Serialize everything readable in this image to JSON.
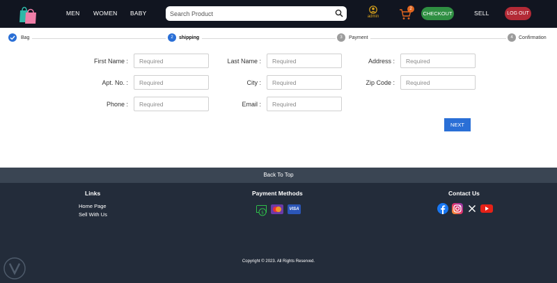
{
  "nav": {
    "links": [
      "MEN",
      "WOMEN",
      "BABY"
    ],
    "search_placeholder": "Search Product",
    "user_name": "admin",
    "cart_count": "2",
    "checkout_label": "CHECKOUT",
    "sell_label": "SELL",
    "logout_label": "LOG OUT"
  },
  "steps": [
    {
      "number": "1",
      "label": "Bag",
      "state": "done"
    },
    {
      "number": "2",
      "label": "shipping",
      "state": "active"
    },
    {
      "number": "3",
      "label": "Payment",
      "state": "pending"
    },
    {
      "number": "4",
      "label": "Confirmation",
      "state": "pending"
    }
  ],
  "form": {
    "first_name_label": "First Name :",
    "last_name_label": "Last Name :",
    "address_label": "Address :",
    "apt_label": "Apt. No. :",
    "city_label": "City :",
    "zip_label": "Zip Code :",
    "phone_label": "Phone :",
    "email_label": "Email :",
    "placeholder": "Required",
    "next_label": "NEXT"
  },
  "footer": {
    "back_to_top": "Back To Top",
    "links_heading": "Links",
    "links": [
      "Home Page",
      "Sell With Us"
    ],
    "payment_heading": "Payment Methods",
    "payment_methods": [
      "cash-icon",
      "mastercard-icon",
      "visa-icon"
    ],
    "visa_text": "VISA",
    "contact_heading": "Contact Us",
    "social": [
      "facebook-icon",
      "instagram-icon",
      "x-icon",
      "youtube-icon"
    ],
    "copyright": "Copyright © 2023. All Rights Reserved."
  },
  "colors": {
    "nav_bg": "#111520",
    "accent_blue": "#2a6fd6",
    "checkout_green": "#2f8f42",
    "logout_red": "#b32a36",
    "footer_bg": "#232c3a"
  }
}
